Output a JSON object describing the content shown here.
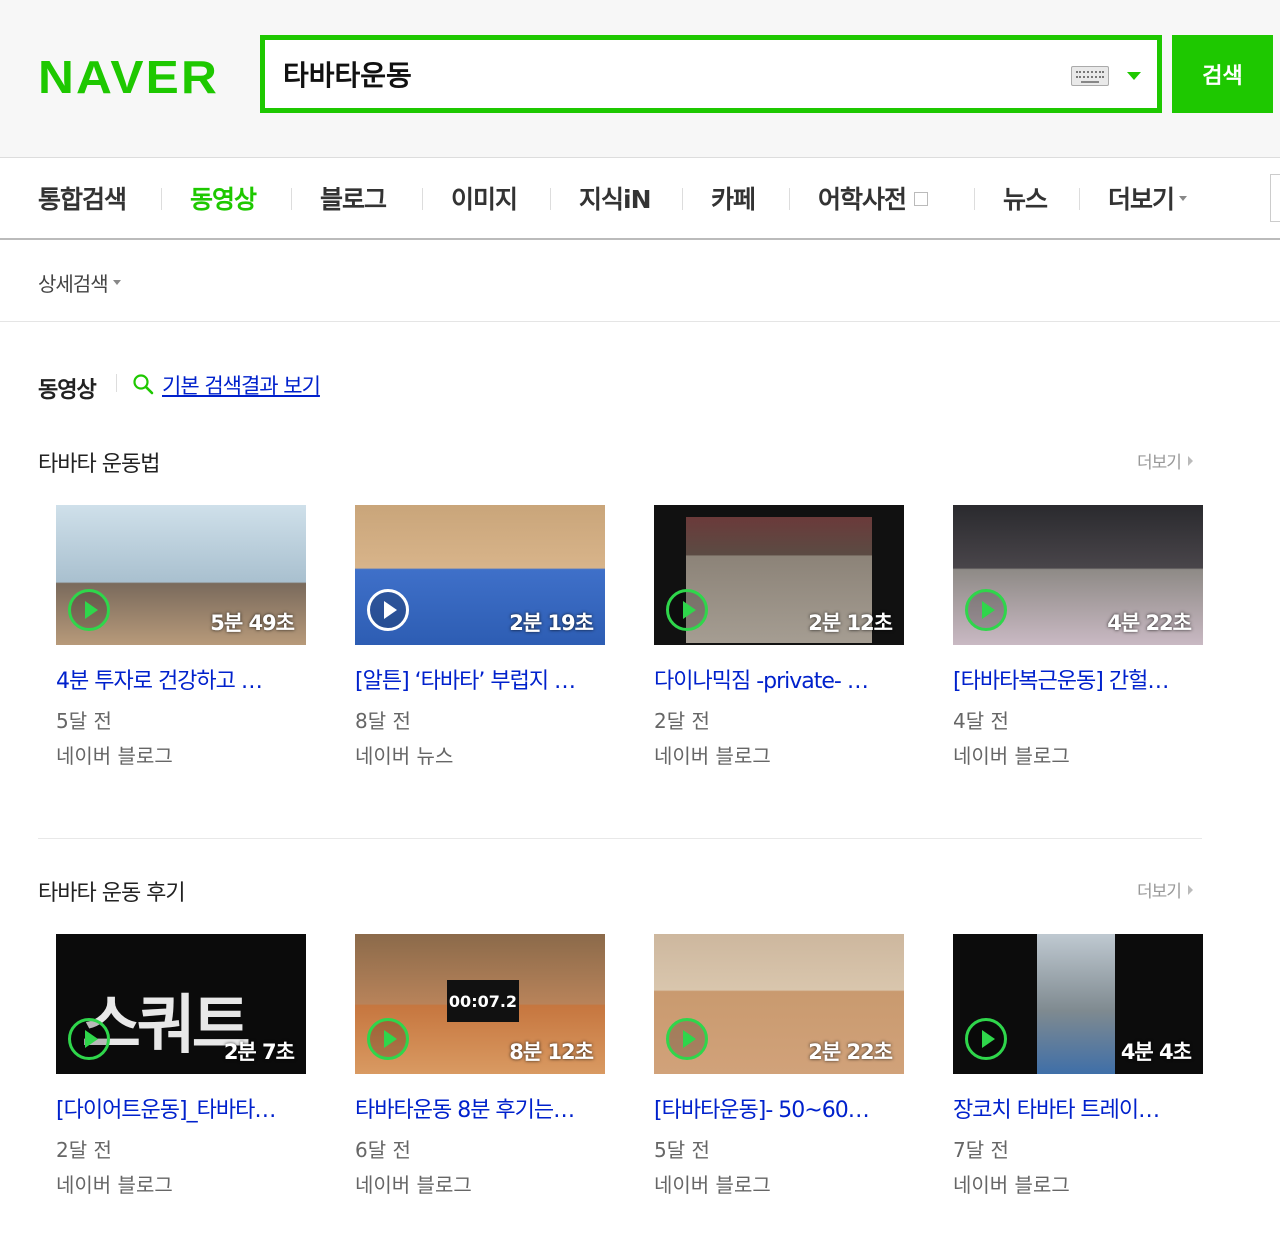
{
  "header": {
    "logo": "NAVER",
    "search_value": "타바타운동",
    "search_button": "검색"
  },
  "nav": {
    "items": [
      "통합검색",
      "동영상",
      "블로그",
      "이미지",
      "지식iN",
      "카페",
      "어학사전",
      "뉴스",
      "더보기"
    ],
    "active": "동영상"
  },
  "options": {
    "detail_search": "상세검색"
  },
  "section": {
    "title": "동영상",
    "basic_link": "기본 검색결과 보기"
  },
  "groups": [
    {
      "title": "타바타 운동법",
      "more": "더보기",
      "cards": [
        {
          "title": "4분 투자로 건강하고 …",
          "duration": "5분 49초",
          "age": "5달 전",
          "source": "네이버 블로그"
        },
        {
          "title": "[알튼] ‘타바타’ 부럽지 …",
          "duration": "2분 19초",
          "age": "8달 전",
          "source": "네이버 뉴스"
        },
        {
          "title": "다이나믹짐 -private- …",
          "duration": "2분 12초",
          "age": "2달 전",
          "source": "네이버 블로그"
        },
        {
          "title": "[타바타복근운동] 간헐…",
          "duration": "4분 22초",
          "age": "4달 전",
          "source": "네이버 블로그"
        }
      ]
    },
    {
      "title": "타바타 운동 후기",
      "more": "더보기",
      "cards": [
        {
          "title": "[다이어트운동]_타바타…",
          "duration": "2분 7초",
          "age": "2달 전",
          "source": "네이버 블로그",
          "thumb_text": "스쿼트"
        },
        {
          "title": "타바타운동 8분 후기는…",
          "duration": "8분 12초",
          "age": "6달 전",
          "source": "네이버 블로그",
          "thumb_text": "00:07.2"
        },
        {
          "title": "[타바타운동]- 50~60…",
          "duration": "2분 22초",
          "age": "5달 전",
          "source": "네이버 블로그"
        },
        {
          "title": "장코치 타바타 트레이…",
          "duration": "4분 4초",
          "age": "7달 전",
          "source": "네이버 블로그"
        }
      ]
    }
  ],
  "colors": {
    "brand": "#1ec800",
    "link": "#0021cc"
  }
}
